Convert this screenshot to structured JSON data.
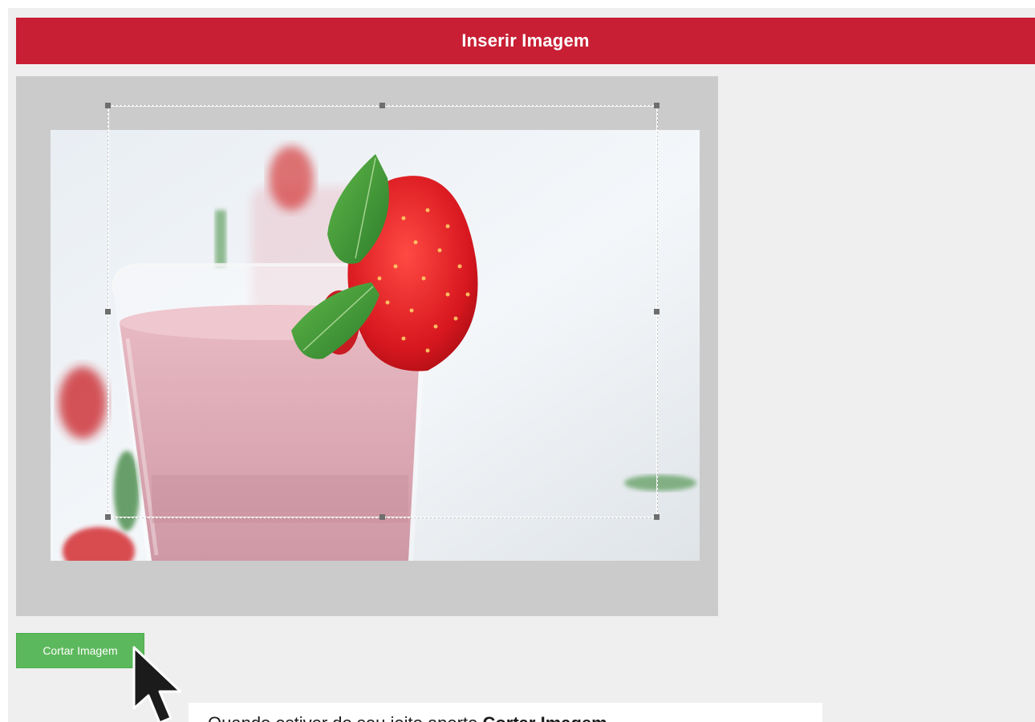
{
  "header": {
    "title": "Inserir Imagem",
    "color": "#c81f34"
  },
  "cropper": {
    "photo_subject": "strawberry smoothie glass with mint leaf",
    "handle_color": "#6e6e6e",
    "stage_color": "#cbcbcb"
  },
  "actions": {
    "crop_button_label": "Cortar Imagem",
    "crop_button_color": "#5cb85c"
  },
  "caption": {
    "prefix": "Quando estiver do seu jeito aperte ",
    "emphasis": "Cortar Imagem"
  },
  "cursor": {
    "icon": "arrow-cursor-icon"
  }
}
